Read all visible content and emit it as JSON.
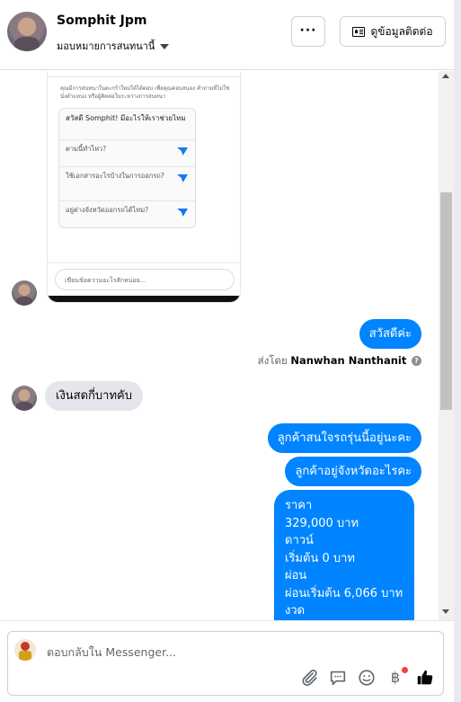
{
  "header": {
    "name": "Somphit Jpm",
    "assign_label": "มอบหมายการสนทนานี้",
    "more_label": "···",
    "contact_label": "ดูข้อมูลติดต่อ"
  },
  "shared_screenshot": {
    "notice": "คุณมีการสนทนาในตะกร้าใหม่ใต้ได้ตอบ เพื่อคุณคอบสนอง คำถามที่ไม่ใช่นั่งตำแหน่ง หรือผู้ติดต่อในระหว่างการสนทนา",
    "greeting": "สวัสดี Somphit! มีอะไรให้เราช่วยไหม",
    "questions": [
      "ตามนี้ทำไหว?",
      "ใช้เอกสารอะไรบ้างในการออกรถ?",
      "อยู่ต่างจังหวัดออกรถได้ไหม?"
    ],
    "input_placeholder": "เขียนข้อความอะไรสักหน่อย..."
  },
  "messages": {
    "greeting_out": "สวัสดีค่ะ",
    "sent_by_prefix": "ส่งโดย",
    "sent_by_name": "Nanwhan Nanthanit",
    "info_icon": "?",
    "incoming_1": "เงินสดกี่บาทคับ",
    "out_1": "ลูกค้าสนใจรถรุ่นนี้อยู่นะคะ",
    "out_2": "ลูกค้าอยู่จังหวัดอะไรคะ",
    "price_lines": [
      "ราคา",
      "329,000 บาท",
      "ดาวน์",
      "เริ่มต้น 0 บาท",
      "ผ่อน",
      "ผ่อนเริ่มต้น 6,066 บาท",
      "งวด"
    ]
  },
  "composer": {
    "placeholder": "ตอบกลับใน Messenger...",
    "baht_symbol": "฿"
  },
  "colors": {
    "accent": "#0084ff",
    "incoming_bubble": "#e4e6eb",
    "notification_dot": "#fa3e3e"
  },
  "icons": [
    "more-icon",
    "contact-card-icon",
    "paperclip-icon",
    "chat-bubble-icon",
    "emoji-icon",
    "baht-icon",
    "thumbs-up-icon"
  ]
}
